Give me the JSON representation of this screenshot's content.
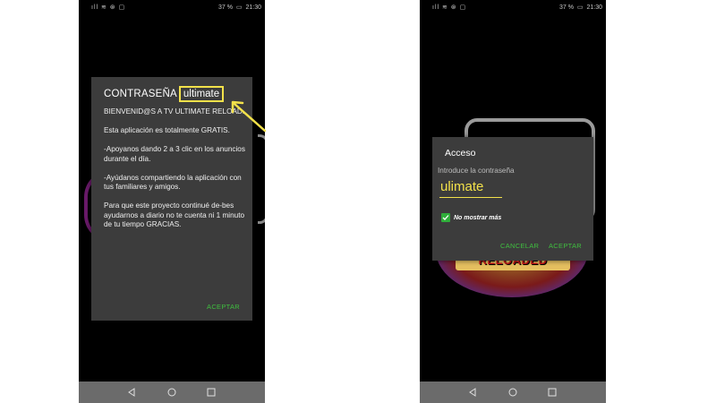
{
  "left_phone": {
    "status": {
      "left_icons": "ıll ≋ ⊛ ▢",
      "battery": "37 %",
      "time": "21:30"
    },
    "dialog": {
      "title": "CONTRASEÑA",
      "password_highlight": "ultimate",
      "paragraphs": [
        "BIENVENID@S A TV ULTIMATE RELOAD.",
        "Esta aplicación es totalmente GRATIS.",
        "-Apoyanos dando 2 a 3 clic en los anuncios durante el día.",
        "-Ayúdanos compartiendo la aplicación con tus familiares y amigos.",
        "Para que este proyecto continué de-bes ayudarnos a diario no te cuenta ni 1 minuto de tu tiempo GRACIAS."
      ],
      "accept_label": "ACEPTAR"
    }
  },
  "right_phone": {
    "status": {
      "left_icons": "ıll ≋ ⊛ ▢",
      "battery": "37 %",
      "time": "21:30"
    },
    "background_logo_text": "RELOADED",
    "dialog": {
      "title": "Acceso",
      "prompt": "Introduce la contraseña",
      "input_value": "ulimate",
      "checkbox_label": "No mostrar más",
      "checkbox_checked": true,
      "cancel_label": "CANCELAR",
      "accept_label": "ACEPTAR"
    }
  },
  "colors": {
    "dialog_bg": "#3c3c3c",
    "accent_green": "#3fbf3f",
    "highlight_yellow": "#f2e14a",
    "nav_bar": "#6b6b6b"
  },
  "icons": [
    "signal-icon",
    "wifi-icon",
    "battery-icon",
    "back-icon",
    "home-icon",
    "recents-icon",
    "checkbox-checked-icon",
    "arrow-annotation-icon"
  ]
}
